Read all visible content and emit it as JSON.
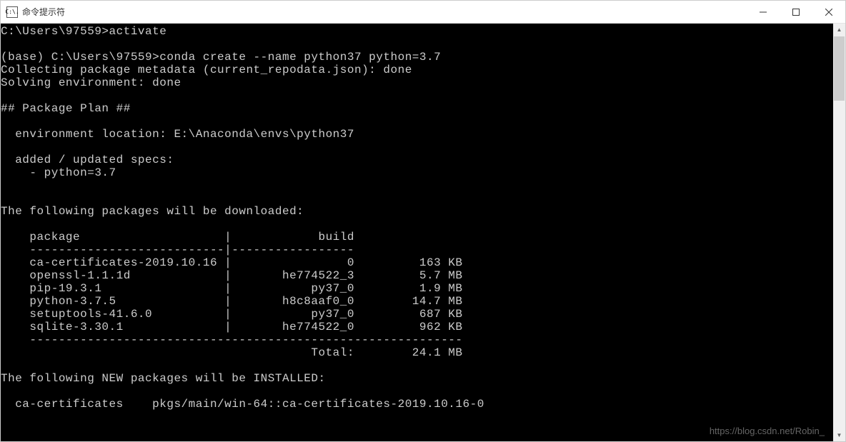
{
  "window": {
    "title": "命令提示符",
    "icon_label": "C:\\."
  },
  "terminal": {
    "lines": [
      "C:\\Users\\97559>activate",
      "",
      "(base) C:\\Users\\97559>conda create --name python37 python=3.7",
      "Collecting package metadata (current_repodata.json): done",
      "Solving environment: done",
      "",
      "## Package Plan ##",
      "",
      "  environment location: E:\\Anaconda\\envs\\python37",
      "",
      "  added / updated specs:",
      "    - python=3.7",
      "",
      "",
      "The following packages will be downloaded:",
      ""
    ],
    "table": {
      "header_package": "    package                    |            build",
      "header_divider": "    ---------------------------|-----------------",
      "rows": [
        "    ca-certificates-2019.10.16 |                0         163 KB",
        "    openssl-1.1.1d             |       he774522_3         5.7 MB",
        "    pip-19.3.1                 |           py37_0         1.9 MB",
        "    python-3.7.5               |       h8c8aaf0_0        14.7 MB",
        "    setuptools-41.6.0          |           py37_0         687 KB",
        "    sqlite-3.30.1              |       he774522_0         962 KB"
      ],
      "footer_divider": "    ------------------------------------------------------------",
      "footer_total": "                                           Total:        24.1 MB"
    },
    "after_table": [
      "",
      "The following NEW packages will be INSTALLED:",
      "",
      "  ca-certificates    pkgs/main/win-64::ca-certificates-2019.10.16-0"
    ]
  },
  "watermark": "https://blog.csdn.net/Robin_"
}
